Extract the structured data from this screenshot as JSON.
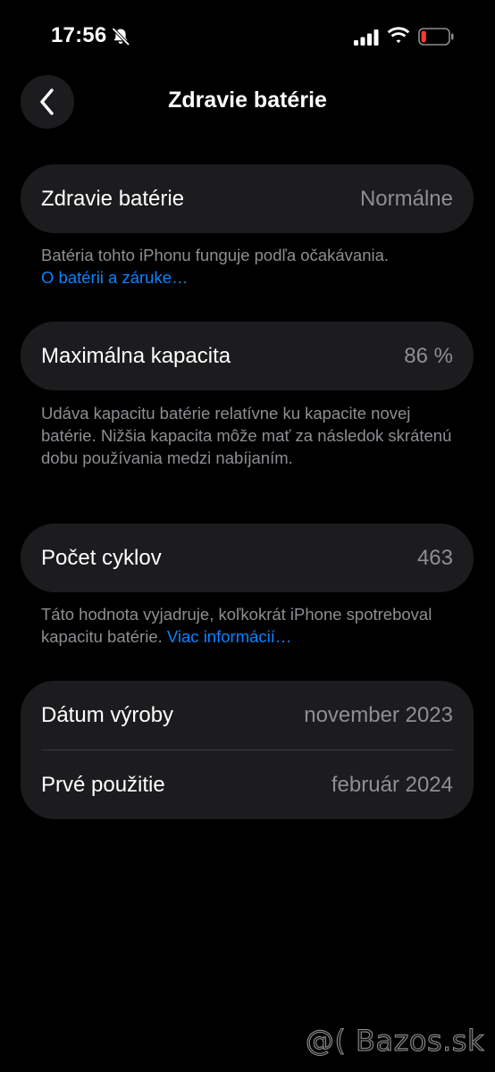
{
  "status_bar": {
    "time": "17:56",
    "icons": [
      "bell-slash-icon",
      "signal-icon",
      "wifi-icon",
      "battery-low-icon"
    ],
    "battery_color": "#ff3b30"
  },
  "nav": {
    "back_icon": "chevron-left-icon",
    "title": "Zdravie batérie"
  },
  "sections": {
    "health": {
      "label": "Zdravie batérie",
      "value": "Normálne",
      "footnote": "Batéria tohto iPhonu funguje podľa očakávania.",
      "link": "O batérii a záruke…"
    },
    "capacity": {
      "label": "Maximálna kapacita",
      "value": "86 %",
      "footnote": "Udáva kapacitu batérie relatívne ku kapacite novej batérie. Nižšia kapacita môže mať za následok skrátenú dobu používania medzi nabíjaním."
    },
    "cycles": {
      "label": "Počet cyklov",
      "value": "463",
      "footnote": "Táto hodnota vyjadruje, koľkokrát iPhone spotreboval kapacitu batérie.",
      "link": "Viac informácií…"
    },
    "dates": {
      "manufacture_label": "Dátum výroby",
      "manufacture_value": "november 2023",
      "first_use_label": "Prvé použitie",
      "first_use_value": "február 2024"
    }
  },
  "watermark": "@( Bazos.sk",
  "colors": {
    "background": "#000000",
    "card": "#1c1c1e",
    "secondary_text": "#8e8e93",
    "link": "#0a84ff"
  }
}
